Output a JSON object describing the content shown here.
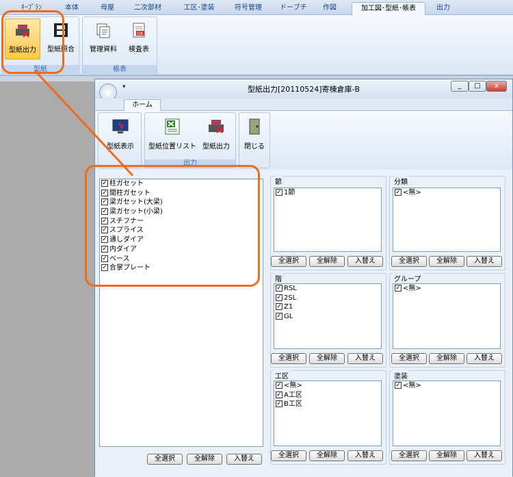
{
  "main_tabs": [
    "ｷｰﾌﾟﾗﾝ",
    "本体",
    "母屋",
    "二次部材",
    "工区･塗装",
    "符号管理",
    "ドーブチ",
    "作図",
    "加工図･型紙･帳表",
    "出力"
  ],
  "ribbon": {
    "groups": [
      {
        "label": "型紙",
        "buttons": [
          "型紙出力",
          "型紙照合"
        ]
      },
      {
        "label": "帳表",
        "buttons": [
          "管理資料",
          "検査表"
        ]
      }
    ]
  },
  "window": {
    "title": "型紙出力[20110524]寄棟倉庫-B",
    "tab": "ホーム",
    "min": "_",
    "max": "□",
    "close": "x",
    "groups": [
      {
        "label": "",
        "buttons": [
          "型紙表示"
        ]
      },
      {
        "label": "出力",
        "buttons": [
          "型紙位置リスト",
          "型紙出力"
        ]
      },
      {
        "label": "",
        "buttons": [
          "閉じる"
        ]
      }
    ]
  },
  "parts": [
    "柱ガセット",
    "間柱ガセット",
    "梁ガセット(大梁)",
    "梁ガセット(小梁)",
    "スチフナー",
    "スプライス",
    "通しダイア",
    "内ダイア",
    "ベース",
    "合掌プレート"
  ],
  "panels": {
    "setsu": {
      "title": "節",
      "items": [
        "1節"
      ]
    },
    "bunrui": {
      "title": "分類",
      "items": [
        "<無>"
      ]
    },
    "kai": {
      "title": "階",
      "items": [
        "RSL",
        "2SL",
        "Z1",
        "GL"
      ]
    },
    "group": {
      "title": "グループ",
      "items": [
        "<無>"
      ]
    },
    "kouku": {
      "title": "工区",
      "items": [
        "<無>",
        "A工区",
        "B工区"
      ]
    },
    "tosou": {
      "title": "塗装",
      "items": [
        "<無>"
      ]
    }
  },
  "buttons": {
    "select_all": "全選択",
    "deselect_all": "全解除",
    "invert": "入替え"
  },
  "accent": "#f26a1b"
}
